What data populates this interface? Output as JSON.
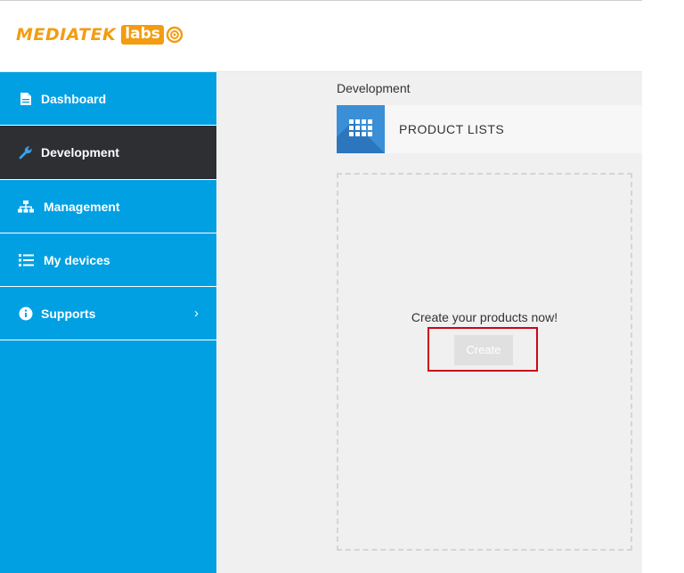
{
  "header": {
    "logo_word": "MEDIATEK",
    "logo_labs": "labs"
  },
  "sidebar": {
    "items": [
      {
        "label": "Dashboard",
        "icon": "document-icon",
        "active": false
      },
      {
        "label": "Development",
        "icon": "wrench-icon",
        "active": true
      },
      {
        "label": "Management",
        "icon": "sitemap-icon",
        "active": false
      },
      {
        "label": "My devices",
        "icon": "list-icon",
        "active": false
      },
      {
        "label": "Supports",
        "icon": "info-icon",
        "active": false,
        "chevron": "›"
      }
    ]
  },
  "main": {
    "breadcrumb": "Development",
    "section_title": "PRODUCT LISTS",
    "empty_message": "Create your products now!",
    "create_label": "Create"
  },
  "colors": {
    "sidebar_bg": "#00a0e3",
    "active_bg": "#2d2f33",
    "brand_orange": "#f39c12",
    "highlight_red": "#d0021b"
  }
}
